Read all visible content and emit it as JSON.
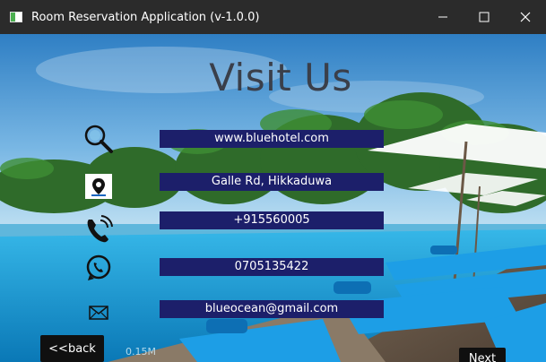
{
  "window": {
    "title": "Room Reservation Application (v-1.0.0)"
  },
  "page": {
    "heading": "Visit Us"
  },
  "contacts": [
    {
      "icon": "search-icon",
      "value": "www.bluehotel.com"
    },
    {
      "icon": "map-pin-icon",
      "value": "Galle Rd, Hikkaduwa"
    },
    {
      "icon": "phone-icon",
      "value": "+915560005"
    },
    {
      "icon": "whatsapp-icon",
      "value": "0705135422"
    },
    {
      "icon": "mail-icon",
      "value": "blueocean@gmail.com"
    }
  ],
  "nav": {
    "back_label": "<<back",
    "next_label": "Next"
  },
  "colors": {
    "field_bg": "#1c1f6a",
    "titlebar_bg": "#2b2b2b",
    "heading_text": "#3a3f4a"
  }
}
